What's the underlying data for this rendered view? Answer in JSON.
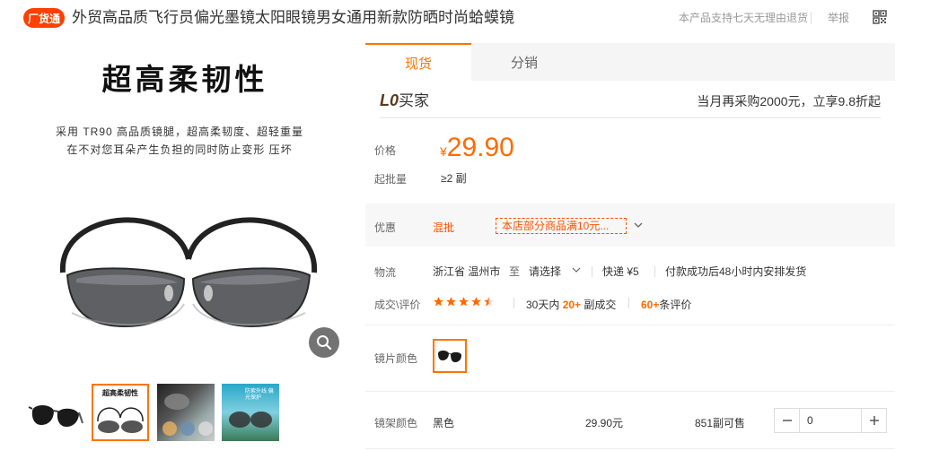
{
  "header": {
    "badge": "厂货通",
    "title": "外贸高品质飞行员偏光墨镜太阳眼镜男女通用新款防晒时尚蛤蟆镜",
    "return_policy": "本产品支持七天无理由退货",
    "report": "举报"
  },
  "gallery": {
    "headline": "超高柔韧性",
    "desc_line1": "采用 TR90 高品质镜腿，超高柔韧度、超轻重量",
    "desc_line2": "在不对您耳朵产生负担的同时防止变形 压坏",
    "thumb_text": "超高柔韧性",
    "thumb_text_3": "防紫外线 偏光保护"
  },
  "tabs": [
    "现货",
    "分销"
  ],
  "buyer": {
    "logo_mark": "L0",
    "logo_text": "买家",
    "promo": "当月再采购2000元，立享9.8折起"
  },
  "price": {
    "label": "价格",
    "symbol": "¥",
    "value": "29.90",
    "min_label": "起批量",
    "min_value": "≥2 副"
  },
  "discount": {
    "label": "优惠",
    "tag": "混批",
    "coupon": "本店部分商品满10元..."
  },
  "shipping": {
    "label": "物流",
    "origin": "浙江省 温州市",
    "to": "至",
    "dest": "请选择",
    "express": "快递 ¥5",
    "dispatch": "付款成功后48小时内安排发货"
  },
  "reviews": {
    "label": "成交\\评价",
    "rating": 4.5,
    "deals_prefix": "30天内",
    "deals_count": "20+",
    "deals_suffix": "副成交",
    "review_count": "60+",
    "review_suffix": "条评价"
  },
  "lens": {
    "label": "镜片颜色"
  },
  "frame": {
    "label": "镜架颜色",
    "color": "黑色",
    "price": "29.90元",
    "stock": "851副可售",
    "qty": "0"
  },
  "colors": {
    "accent": "#ff7300",
    "price": "#ff6a00",
    "badge": "#ff4000"
  }
}
